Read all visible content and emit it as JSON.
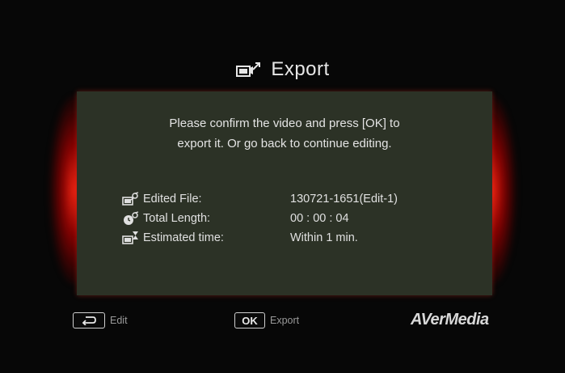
{
  "dialog": {
    "title": "Export",
    "message_line1": "Please confirm the video and press [OK] to",
    "message_line2": "export it. Or go back to continue editing.",
    "rows": [
      {
        "icon": "film-edit-icon",
        "label": "Edited File:",
        "value": "130721-1651(Edit-1)"
      },
      {
        "icon": "clock-film-icon",
        "label": "Total Length:",
        "value": "00 : 00 : 04"
      },
      {
        "icon": "hourglass-film-icon",
        "label": "Estimated time:",
        "value": "Within 1 min."
      }
    ]
  },
  "footer": {
    "edit_label": "Edit",
    "ok_key_label": "OK",
    "export_label": "Export",
    "brand": "AVerMedia"
  },
  "colors": {
    "background": "#070707",
    "panel": "#2c3226",
    "glow": "#ff2814",
    "text": "#e4e4e4"
  }
}
